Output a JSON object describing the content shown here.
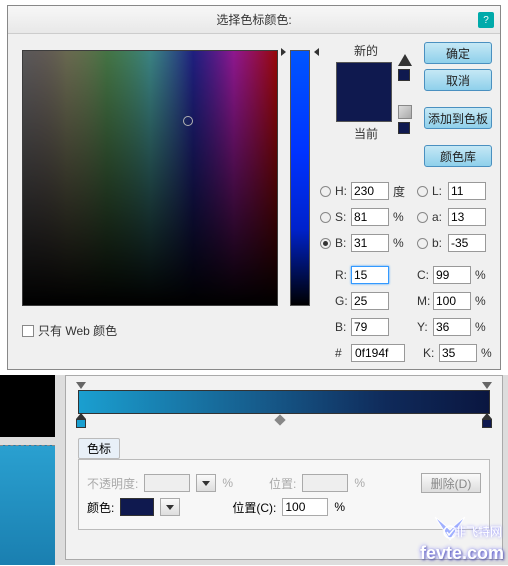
{
  "dialog": {
    "title": "选择色标颜色:",
    "help": "?",
    "new_label": "新的",
    "current_label": "当前",
    "buttons": {
      "ok": "确定",
      "cancel": "取消",
      "add_swatch": "添加到色板",
      "color_lib": "颜色库"
    },
    "hsb": {
      "h_label": "H:",
      "h": "230",
      "h_unit": "度",
      "s_label": "S:",
      "s": "81",
      "s_unit": "%",
      "b_label": "B:",
      "b": "31",
      "b_unit": "%"
    },
    "lab": {
      "l_label": "L:",
      "l": "11",
      "a_label": "a:",
      "a": "13",
      "b_label": "b:",
      "b": "-35"
    },
    "rgb": {
      "r_label": "R:",
      "r": "15",
      "g_label": "G:",
      "g": "25",
      "b_label": "B:",
      "b": "79"
    },
    "cmyk": {
      "c_label": "C:",
      "c": "99",
      "unit": "%",
      "m_label": "M:",
      "m": "100",
      "y_label": "Y:",
      "y": "36",
      "k_label": "K:",
      "k": "35"
    },
    "hex_label": "#",
    "hex": "0f194f",
    "web_only": "只有 Web 颜色",
    "swatch_new_color": "#0f194f",
    "swatch_cur_color": "#0f194f"
  },
  "gradient": {
    "section": "色标",
    "opacity_label": "不透明度:",
    "opacity": "",
    "position_label_dis": "位置:",
    "position_dis": "",
    "delete": "删除(D)",
    "color_label": "颜色:",
    "swatch_color": "#0f194f",
    "position_label": "位置(C):",
    "position": "100",
    "unit": "%"
  },
  "watermark": {
    "site": "fevte.com",
    "cn": "非飞特网"
  }
}
